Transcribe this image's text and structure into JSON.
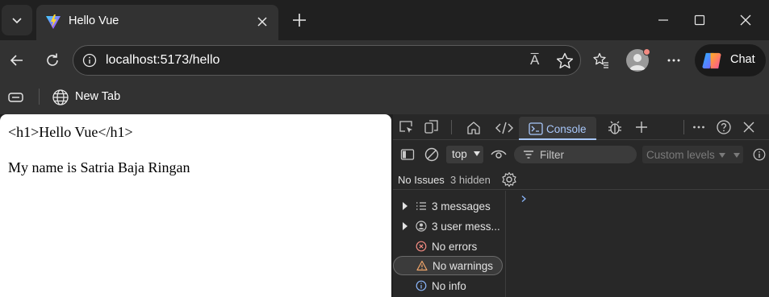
{
  "browser": {
    "tab": {
      "title": "Hello Vue"
    },
    "address_bar": {
      "url": "localhost:5173/hello"
    },
    "read_aloud_glyph": "A̅",
    "copilot": {
      "label": "Chat"
    },
    "favorites": [
      {
        "label": "New Tab"
      }
    ]
  },
  "page": {
    "lines": [
      "<h1>Hello Vue</h1>",
      "My name is Satria Baja Ringan"
    ]
  },
  "devtools": {
    "active_tab": "Console",
    "context": "top",
    "filter_placeholder": "Filter",
    "levels": "Custom levels",
    "issues": {
      "label": "No Issues",
      "hidden": "3 hidden"
    },
    "sidebar": [
      {
        "label": "3 messages",
        "icon": "list-icon",
        "expandable": true,
        "selected": false
      },
      {
        "label": "3 user mess...",
        "icon": "user-icon",
        "expandable": true,
        "selected": false
      },
      {
        "label": "No errors",
        "icon": "error-icon",
        "expandable": false,
        "selected": false
      },
      {
        "label": "No warnings",
        "icon": "warning-icon",
        "expandable": false,
        "selected": true
      },
      {
        "label": "No info",
        "icon": "info-icon",
        "expandable": false,
        "selected": false
      }
    ]
  },
  "colors": {
    "accent": "#a8c7fa",
    "error": "#f28b82",
    "warning": "#f0a56a",
    "info": "#8ab4f8"
  }
}
